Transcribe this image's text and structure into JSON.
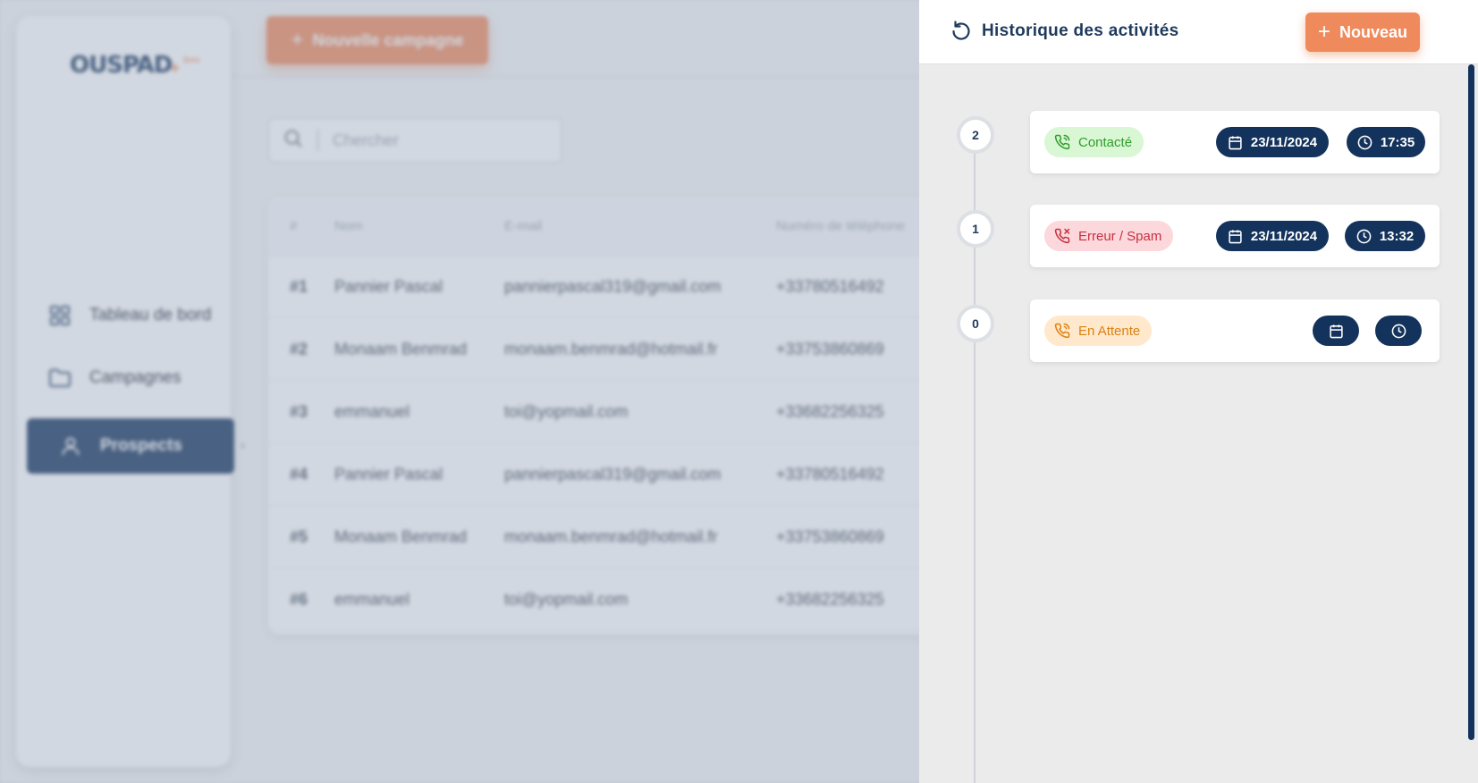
{
  "logo": {
    "text": "OUSPAD",
    "plus": "+",
    "badge": "Beta"
  },
  "nav": {
    "items": [
      {
        "label": "Tableau de bord",
        "icon": "grid-icon"
      },
      {
        "label": "Campagnes",
        "icon": "folder-icon"
      },
      {
        "label": "Prospects",
        "icon": "user-icon",
        "active": true
      }
    ]
  },
  "toolbar": {
    "new_campaign_label": "Nouvelle campagne"
  },
  "search": {
    "placeholder": "Chercher"
  },
  "table": {
    "headers": [
      "#",
      "Nom",
      "E-mail",
      "Numéro de téléphone"
    ],
    "rows": [
      {
        "id": "#1",
        "name": "Pannier Pascal",
        "email": "pannierpascal319@gmail.com",
        "phone": "+33780516492"
      },
      {
        "id": "#2",
        "name": "Monaam Benmrad",
        "email": "monaam.benmrad@hotmail.fr",
        "phone": "+33753860869"
      },
      {
        "id": "#3",
        "name": "emmanuel",
        "email": "toi@yopmail.com",
        "phone": "+33682256325"
      },
      {
        "id": "#4",
        "name": "Pannier Pascal",
        "email": "pannierpascal319@gmail.com",
        "phone": "+33780516492"
      },
      {
        "id": "#5",
        "name": "Monaam Benmrad",
        "email": "monaam.benmrad@hotmail.fr",
        "phone": "+33753860869"
      },
      {
        "id": "#6",
        "name": "emmanuel",
        "email": "toi@yopmail.com",
        "phone": "+33682256325"
      }
    ]
  },
  "drawer": {
    "title": "Historique des activités",
    "new_label": "Nouveau",
    "activities": [
      {
        "index": "2",
        "status": "Contacté",
        "status_color": "#2f9e2a",
        "date": "23/11/2024",
        "time": "17:35"
      },
      {
        "index": "1",
        "status": "Erreur / Spam",
        "status_color": "#c7303d",
        "date": "23/11/2024",
        "time": "13:32"
      },
      {
        "index": "0",
        "status": "En Attente",
        "status_color": "#d98213",
        "date": "",
        "time": ""
      }
    ]
  },
  "colors": {
    "brand": "#14335c",
    "accent": "#ef8a5c"
  }
}
